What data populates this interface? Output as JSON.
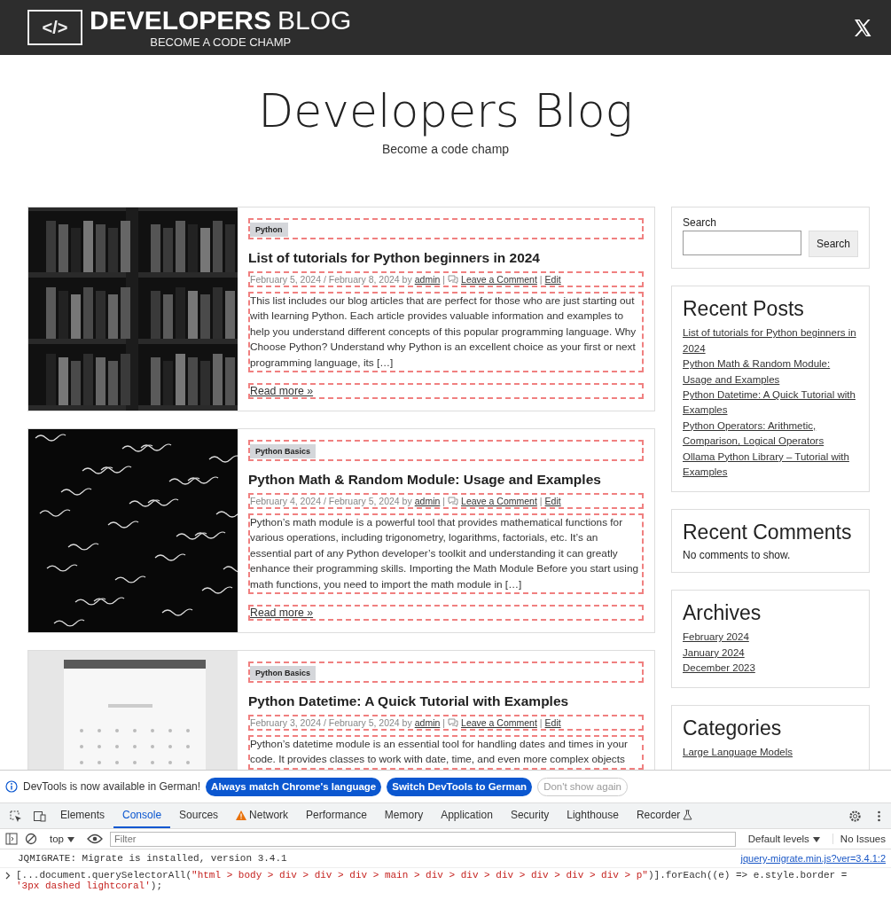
{
  "header": {
    "logo_mark": "</>",
    "brand_bold": "DEVELOPERS",
    "brand_light": "BLOG",
    "tagline": "BECOME A CODE CHAMP"
  },
  "site": {
    "title": "Developers Blog",
    "tagline": "Become a code champ"
  },
  "posts": [
    {
      "category": "Python",
      "title": "List of tutorials for Python beginners in 2024",
      "dates": "February 5, 2024 / February 8, 2024 by",
      "author": "admin",
      "separator": "|",
      "comment": "Leave a Comment",
      "edit": "Edit",
      "excerpt": "This list includes our blog articles that are perfect for those who are just starting out with learning Python. Each article provides valuable information and examples to help you understand different concepts of this popular programming language. Why Choose Python? Understand why Python is an excellent choice as your first or next programming language, its […]",
      "read_more": "Read more »"
    },
    {
      "category": "Python Basics",
      "title": "Python Math & Random Module: Usage and Examples",
      "dates": "February 4, 2024 / February 5, 2024 by",
      "author": "admin",
      "separator": "|",
      "comment": "Leave a Comment",
      "edit": "Edit",
      "excerpt": "Python’s math module is a powerful tool that provides mathematical functions for various operations, including trigonometry, logarithms, factorials, etc. It’s an essential part of any Python developer’s toolkit and understanding it can greatly enhance their programming skills. Importing the Math Module Before you start using math functions, you need to import the math module in […]",
      "read_more": "Read more »"
    },
    {
      "category": "Python Basics",
      "title": "Python Datetime: A Quick Tutorial with Examples",
      "dates": "February 3, 2024 / February 5, 2024 by",
      "author": "admin",
      "separator": "|",
      "comment": "Leave a Comment",
      "edit": "Edit",
      "excerpt": "Python’s datetime module is an essential tool for handling dates and times in your code. It provides classes to work with date, time, and even more complex objects"
    }
  ],
  "sidebar": {
    "search": {
      "label": "Search",
      "button": "Search"
    },
    "widgets": [
      {
        "kind": "links",
        "title": "Recent Posts",
        "items": [
          "List of tutorials for Python beginners in 2024",
          "Python Math & Random Module: Usage and Examples",
          "Python Datetime: A Quick Tutorial with Examples",
          "Python Operators: Arithmetic, Comparison, Logical Operators",
          "Ollama Python Library – Tutorial with Examples"
        ]
      },
      {
        "kind": "text",
        "title": "Recent Comments",
        "text": "No comments to show."
      },
      {
        "kind": "links",
        "title": "Archives",
        "items": [
          "February 2024",
          "January 2024",
          "December 2023"
        ]
      },
      {
        "kind": "links",
        "title": "Categories",
        "items": [
          "Large Language Models"
        ]
      }
    ]
  },
  "devtools": {
    "infobar": {
      "message": "DevTools is now available in German!",
      "buttons": [
        {
          "kind": "primary",
          "label": "Always match Chrome's language"
        },
        {
          "kind": "primary",
          "label": "Switch DevTools to German"
        },
        {
          "kind": "outline",
          "label": "Don't show again"
        }
      ]
    },
    "tabs": [
      {
        "label": "Elements",
        "selected": false,
        "kind": "plain"
      },
      {
        "label": "Console",
        "selected": true,
        "kind": "plain"
      },
      {
        "label": "Sources",
        "selected": false,
        "kind": "plain"
      },
      {
        "label": "Network",
        "selected": false,
        "kind": "warning"
      },
      {
        "label": "Performance",
        "selected": false,
        "kind": "plain"
      },
      {
        "label": "Memory",
        "selected": false,
        "kind": "plain"
      },
      {
        "label": "Application",
        "selected": false,
        "kind": "plain"
      },
      {
        "label": "Security",
        "selected": false,
        "kind": "plain"
      },
      {
        "label": "Lighthouse",
        "selected": false,
        "kind": "plain"
      },
      {
        "label": "Recorder",
        "selected": false,
        "kind": "experimental"
      }
    ],
    "toolbar": {
      "context": "top",
      "filter_placeholder": "Filter",
      "levels": "Default levels",
      "issues": "No Issues"
    },
    "messages": [
      {
        "kind": "log",
        "text": "JQMIGRATE: Migrate is installed, version 3.4.1",
        "source": "jquery-migrate.min.js?ver=3.4.1:2"
      },
      {
        "kind": "input",
        "parts": [
          {
            "kind": "code",
            "text": "[...document.querySelectorAll("
          },
          {
            "kind": "string",
            "text": "\"html > body > div > div > div > main > div > div > div > div > div > div > p\""
          },
          {
            "kind": "code",
            "text": ")].forEach((e) => e.style.border = "
          },
          {
            "kind": "string",
            "text": "'3px dashed lightcoral'"
          },
          {
            "kind": "code",
            "text": ");"
          }
        ]
      }
    ]
  }
}
